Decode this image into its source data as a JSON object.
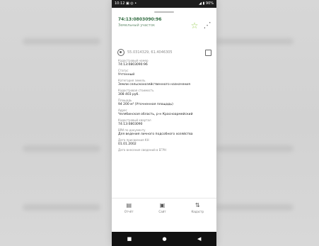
{
  "statusbar": {
    "left": "10:12 ▣ ◎ •",
    "right": "◢ ▮ 90%"
  },
  "header": {
    "title": "74:13:0803090:96",
    "subtitle": "Земельный участок"
  },
  "coordinates": {
    "value": "55.0314329, 61.4046305"
  },
  "fields": [
    {
      "label": "Кадастровый номер",
      "value": "74:13:0803090:96"
    },
    {
      "label": "Статус",
      "value": "Учтенный"
    },
    {
      "label": "Категория земель",
      "value": "Земли сельскохозяйственного назначения"
    },
    {
      "label": "Кадастровая стоимость",
      "value": "308 403 руб."
    },
    {
      "label": "Площадь",
      "value": "94 200 м² (Уточненная площадь)"
    },
    {
      "label": "Адрес",
      "value": "Челябинская область, р-н Красноармейский"
    },
    {
      "label": "Кадастровый квартал",
      "value": "74:13:0803090"
    },
    {
      "label": "ВРИ по документу",
      "value": "Для ведения личного подсобного хозяйства"
    },
    {
      "label": "Дата присвоения КН",
      "value": "01.01.2002"
    },
    {
      "label": "Дата внесения сведений в ЕГРН",
      "value": ""
    }
  ],
  "bottomnav": [
    {
      "label": "Отчёт",
      "icon": "report-icon"
    },
    {
      "label": "Сайт",
      "icon": "document-icon"
    },
    {
      "label": "Кадастр",
      "icon": "map-icon"
    }
  ],
  "icons": {
    "star": "star-icon",
    "share": "share-icon",
    "location": "target-icon",
    "copy": "copy-icon"
  },
  "sysnav": {
    "left": "■",
    "center": "●",
    "right": "◀"
  }
}
